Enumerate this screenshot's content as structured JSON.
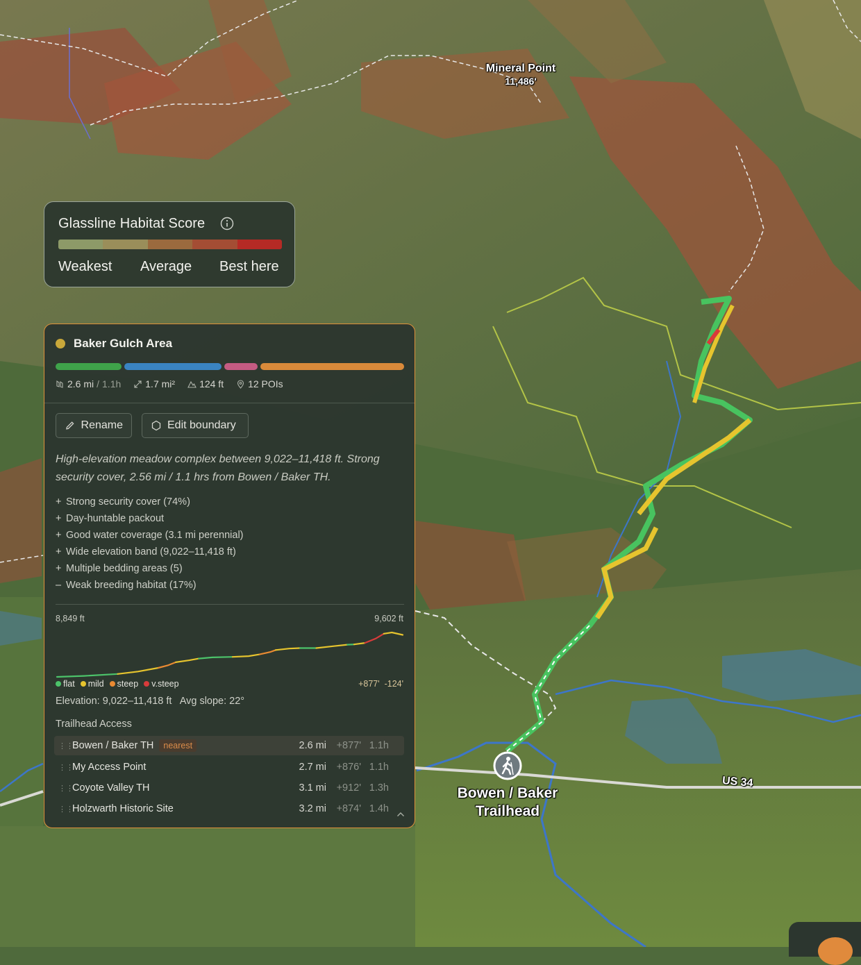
{
  "map": {
    "peak": {
      "name": "Mineral Point",
      "elevation": "11,486'"
    },
    "trailhead_label": {
      "line1": "Bowen / Baker",
      "line2": "Trailhead"
    },
    "road_label": "US 34",
    "icons": {
      "trailhead_marker": "hiker-icon"
    }
  },
  "legend": {
    "title": "Glassline Habitat Score",
    "labels": [
      "Weakest",
      "Average",
      "Best here"
    ],
    "colors": [
      "#8d9a68",
      "#9a8e5a",
      "#9b6a3e",
      "#a44d34",
      "#b52a25"
    ]
  },
  "area": {
    "title": "Baker Gulch Area",
    "dot_color": "#c9a83a",
    "segments": [
      {
        "color": "#3fa34a",
        "weight": 95
      },
      {
        "color": "#3a84c2",
        "weight": 140
      },
      {
        "color": "#c45b82",
        "weight": 48
      },
      {
        "color": "#d98a3a",
        "weight": 207
      }
    ],
    "stats": {
      "distance": "2.6 mi",
      "time": "1.1h",
      "area": "1.7 mi²",
      "gain": "124 ft",
      "pois": "12 POIs"
    },
    "buttons": {
      "rename": "Rename",
      "edit_boundary": "Edit boundary"
    },
    "description": "High-elevation meadow complex between 9,022–11,418 ft. Strong security cover, 2.56 mi / 1.1 hrs from Bowen / Baker TH.",
    "traits": [
      {
        "sign": "+",
        "text": "Strong security cover (74%)"
      },
      {
        "sign": "+",
        "text": "Day-huntable packout"
      },
      {
        "sign": "+",
        "text": "Good water coverage (3.1 mi perennial)"
      },
      {
        "sign": "+",
        "text": "Wide elevation band (9,022–11,418 ft)"
      },
      {
        "sign": "+",
        "text": "Multiple bedding areas (5)"
      },
      {
        "sign": "–",
        "text": "Weak breeding habitat (17%)"
      }
    ],
    "profile": {
      "min_label": "8,849 ft",
      "max_label": "9,602 ft",
      "slope_legend": [
        {
          "label": "flat",
          "color": "#4cc36a"
        },
        {
          "label": "mild",
          "color": "#e6c42e"
        },
        {
          "label": "steep",
          "color": "#e98a32"
        },
        {
          "label": "v.steep",
          "color": "#d83b3b"
        }
      ],
      "gain_loss": "+877'  -124'",
      "summary": "Elevation: 9,022–11,418 ft   Avg slope: 22°",
      "segments": [
        {
          "slope": "flat",
          "pts": [
            [
              0,
              8858
            ],
            [
              0.2,
              8862
            ],
            [
              0.45,
              8870
            ]
          ]
        },
        {
          "slope": "mild",
          "pts": [
            [
              0.45,
              8870
            ],
            [
              0.6,
              8880
            ],
            [
              0.75,
              8895
            ]
          ]
        },
        {
          "slope": "steep",
          "pts": [
            [
              0.75,
              8895
            ],
            [
              0.82,
              8905
            ],
            [
              0.88,
              8918
            ]
          ]
        },
        {
          "slope": "mild",
          "pts": [
            [
              0.88,
              8918
            ],
            [
              0.98,
              8926
            ],
            [
              1.05,
              8933
            ]
          ]
        },
        {
          "slope": "flat",
          "pts": [
            [
              1.05,
              8933
            ],
            [
              1.15,
              8938
            ],
            [
              1.3,
              8940
            ]
          ]
        },
        {
          "slope": "mild",
          "pts": [
            [
              1.3,
              8940
            ],
            [
              1.42,
              8943
            ],
            [
              1.5,
              8950
            ]
          ]
        },
        {
          "slope": "steep",
          "pts": [
            [
              1.5,
              8950
            ],
            [
              1.58,
              8960
            ],
            [
              1.62,
              8968
            ]
          ]
        },
        {
          "slope": "mild",
          "pts": [
            [
              1.62,
              8968
            ],
            [
              1.72,
              8974
            ],
            [
              1.8,
              8976
            ]
          ]
        },
        {
          "slope": "flat",
          "pts": [
            [
              1.8,
              8976
            ],
            [
              1.92,
              8976
            ]
          ]
        },
        {
          "slope": "mild",
          "pts": [
            [
              1.92,
              8976
            ],
            [
              2.05,
              8984
            ],
            [
              2.15,
              8990
            ]
          ]
        },
        {
          "slope": "flat",
          "pts": [
            [
              2.15,
              8990
            ],
            [
              2.2,
              8991
            ]
          ]
        },
        {
          "slope": "mild",
          "pts": [
            [
              2.2,
              8991
            ],
            [
              2.28,
              8997
            ]
          ]
        },
        {
          "slope": "v.steep",
          "pts": [
            [
              2.28,
              8997
            ],
            [
              2.36,
              9015
            ],
            [
              2.42,
              9035
            ]
          ]
        },
        {
          "slope": "mild",
          "pts": [
            [
              2.42,
              9035
            ],
            [
              2.48,
              9040
            ],
            [
              2.56,
              9030
            ]
          ]
        }
      ]
    },
    "trailhead_access": {
      "heading": "Trailhead Access",
      "rows": [
        {
          "name": "Bowen / Baker TH",
          "badge": "nearest",
          "distance": "2.6 mi",
          "gain": "+877'",
          "time": "1.1h"
        },
        {
          "name": "My Access Point",
          "distance": "2.7 mi",
          "gain": "+876'",
          "time": "1.1h"
        },
        {
          "name": "Coyote Valley TH",
          "distance": "3.1 mi",
          "gain": "+912'",
          "time": "1.3h"
        },
        {
          "name": "Holzwarth Historic Site",
          "distance": "3.2 mi",
          "gain": "+874'",
          "time": "1.4h"
        }
      ]
    }
  }
}
